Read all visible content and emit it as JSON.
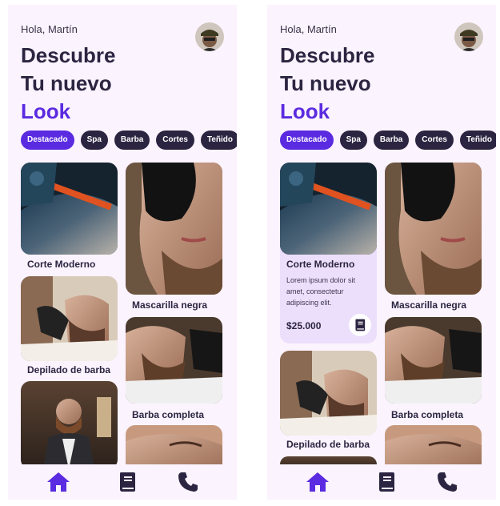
{
  "screens": [
    {
      "greeting": "Hola, Martín",
      "headline": [
        "Descubre",
        "Tu nuevo",
        "Look"
      ],
      "chips": [
        "Destacado",
        "Spa",
        "Barba",
        "Cortes",
        "Teñido"
      ],
      "active_chip": "Destacado",
      "cards": [
        {
          "title": "Corte Moderno"
        },
        {
          "title": "Depilado de barba"
        },
        {
          "title": "Mascarilla negra"
        },
        {
          "title": "Barba completa"
        }
      ]
    },
    {
      "greeting": "Hola, Martín",
      "headline": [
        "Descubre",
        "Tu nuevo",
        "Look"
      ],
      "chips": [
        "Destacado",
        "Spa",
        "Barba",
        "Cortes",
        "Teñido"
      ],
      "active_chip": "Destacado",
      "cards": [
        {
          "title": "Corte Moderno",
          "description": "Lorem ipsum dolor sit amet, consectetur adipiscing elit.",
          "price": "$25.000"
        },
        {
          "title": "Depilado de barba"
        },
        {
          "title": "Mascarilla negra"
        },
        {
          "title": "Barba completa"
        }
      ]
    }
  ],
  "nav": [
    "home-icon",
    "book-icon",
    "phone-icon"
  ],
  "colors": {
    "accent": "#5a2be0",
    "dark": "#2c2541",
    "background": "#fbf3fe",
    "card_expanded": "#ecdffc"
  }
}
